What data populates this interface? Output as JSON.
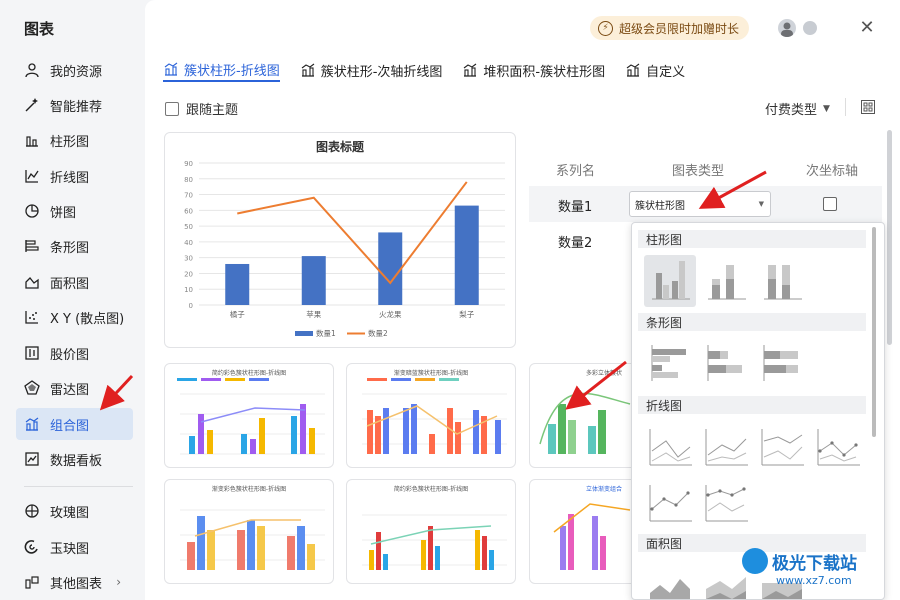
{
  "sidebar": {
    "title": "图表",
    "items": [
      {
        "label": "我的资源",
        "icon": "user-icon"
      },
      {
        "label": "智能推荐",
        "icon": "magic-wand-icon"
      },
      {
        "label": "柱形图",
        "icon": "bar-chart-icon"
      },
      {
        "label": "折线图",
        "icon": "line-chart-icon"
      },
      {
        "label": "饼图",
        "icon": "pie-chart-icon"
      },
      {
        "label": "条形图",
        "icon": "horizontal-bar-icon"
      },
      {
        "label": "面积图",
        "icon": "area-chart-icon"
      },
      {
        "label": "X Y (散点图)",
        "icon": "scatter-icon"
      },
      {
        "label": "股价图",
        "icon": "stock-chart-icon"
      },
      {
        "label": "雷达图",
        "icon": "radar-chart-icon"
      },
      {
        "label": "组合图",
        "icon": "combo-chart-icon",
        "active": true
      },
      {
        "label": "数据看板",
        "icon": "dashboard-icon"
      },
      {
        "label": "玫瑰图",
        "icon": "rose-chart-icon"
      },
      {
        "label": "玉玦图",
        "icon": "ring-chart-icon"
      },
      {
        "label": "其他图表",
        "icon": "more-charts-icon"
      }
    ]
  },
  "header": {
    "vip_label": "超级会员限时加赠时长",
    "close": "✕"
  },
  "tabs": [
    {
      "label": "簇状柱形-折线图",
      "active": true
    },
    {
      "label": "簇状柱形-次轴折线图",
      "active": false
    },
    {
      "label": "堆积面积-簇状柱形图",
      "active": false
    },
    {
      "label": "自定义",
      "active": false
    }
  ],
  "toolbar": {
    "follow_theme": "跟随主题",
    "paid_type": "付费类型"
  },
  "preview": {
    "chart_title": "图表标题"
  },
  "chart_data": {
    "type": "bar",
    "title": "图表标题",
    "categories": [
      "橘子",
      "苹果",
      "火龙果",
      "梨子"
    ],
    "series": [
      {
        "name": "数量1",
        "type": "bar",
        "color": "#4472c4",
        "values": [
          26,
          31,
          46,
          63
        ]
      },
      {
        "name": "数量2",
        "type": "line",
        "color": "#ed7d31",
        "values": [
          58,
          68,
          14,
          78
        ]
      }
    ],
    "ylim": [
      0,
      90
    ],
    "yticks": [
      0,
      10,
      20,
      30,
      40,
      50,
      60,
      70,
      80,
      90
    ],
    "grid": true,
    "legend": "bottom"
  },
  "thumbnails": [
    {
      "title": "简约彩色簇状柱形图-折线图"
    },
    {
      "title": "渐变暗蓝簇状柱形图-折线图"
    },
    {
      "title": "多彩立体簇状"
    },
    {
      "title": "渐变彩色簇状柱形图-折线图"
    },
    {
      "title": "简约彩色簇状柱形图-折线图"
    },
    {
      "title": "立体渐变组合"
    }
  ],
  "series_table": {
    "headers": [
      "系列名",
      "图表类型",
      "次坐标轴"
    ],
    "rows": [
      {
        "name": "数量1",
        "type": "簇状柱形图"
      },
      {
        "name": "数量2",
        "type": ""
      }
    ]
  },
  "dropdown": {
    "groups": [
      "柱形图",
      "条形图",
      "折线图",
      "面积图"
    ]
  },
  "watermark": {
    "brand": "极光下载站",
    "url": "www.xz7.com"
  },
  "colors": {
    "accent": "#2b63d9",
    "bar": "#4472c4",
    "line": "#ed7d31",
    "arrow": "#e02020"
  }
}
